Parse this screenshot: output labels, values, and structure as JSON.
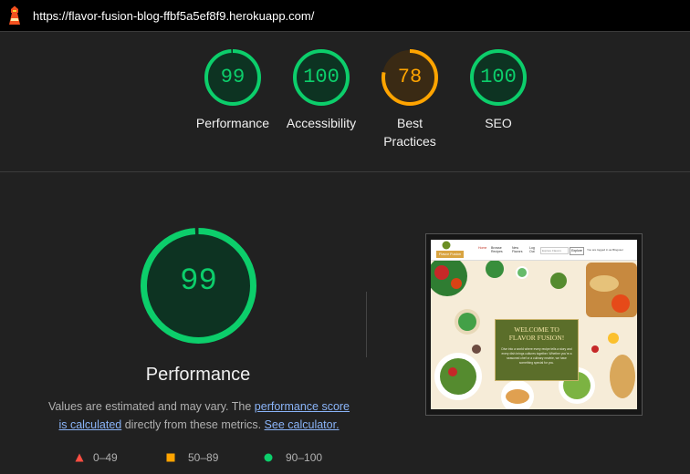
{
  "header": {
    "logo_icon": "lighthouse-icon",
    "url": "https://flavor-fusion-blog-ffbf5a5ef8f9.herokuapp.com/"
  },
  "scores": [
    {
      "value": 99,
      "label": "Performance",
      "color": "#0cce6b"
    },
    {
      "value": 100,
      "label": "Accessibility",
      "color": "#0cce6b"
    },
    {
      "value": 78,
      "label_line1": "Best",
      "label_line2": "Practices",
      "color": "#ffa400"
    },
    {
      "value": 100,
      "label": "SEO",
      "color": "#0cce6b"
    }
  ],
  "performance": {
    "score": 99,
    "title": "Performance",
    "desc_prefix": "Values are estimated and may vary. The ",
    "link_score": "performance score",
    "link_calculated": "is calculated",
    "desc_middle": " directly from these metrics. ",
    "link_calculator": "See calculator.",
    "color": "#0cce6b"
  },
  "legend": [
    {
      "range": "0–49",
      "shape": "triangle",
      "color": "#ff4e42"
    },
    {
      "range": "50–89",
      "shape": "square",
      "color": "#ffa400"
    },
    {
      "range": "90–100",
      "shape": "circle",
      "color": "#0cce6b"
    }
  ],
  "screenshot": {
    "brand": "Flavor Fusion",
    "nav_home": "Home",
    "nav_browse_1": "Browse",
    "nav_browse_2": "Recipes",
    "nav_new_1": "New",
    "nav_new_2": "Flavors",
    "nav_log_1": "Log",
    "nav_log_2": "Out",
    "search_placeholder": "Explore Flavors",
    "explore_label": "Explore",
    "logged_in": "You are logged in as Bloguser",
    "hero_title_1": "WELCOME TO",
    "hero_title_2": "FLAVOR FUSION!",
    "hero_text": "Dive into a world where every recipe tells a story and every dish brings cultures together. Whether you're a seasoned chef or a culinary newbie, we have something special for you."
  }
}
